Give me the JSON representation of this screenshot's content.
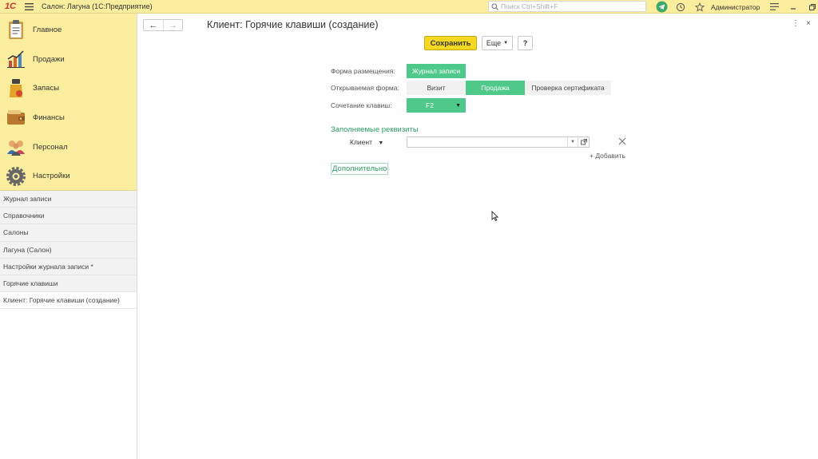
{
  "titlebar": {
    "logo": "1С",
    "app_title": "Салон: Лагуна  (1С:Предприятие)",
    "search_placeholder": "Поиск Ctrl+Shift+F",
    "user": "Администратор"
  },
  "sidebar": {
    "sections": [
      {
        "label": "Главное",
        "icon": "clipboard-icon"
      },
      {
        "label": "Продажи",
        "icon": "sales-chart-icon"
      },
      {
        "label": "Запасы",
        "icon": "goods-icon"
      },
      {
        "label": "Финансы",
        "icon": "wallet-icon"
      },
      {
        "label": "Персонал",
        "icon": "people-icon"
      },
      {
        "label": "Настройки",
        "icon": "gear-icon"
      }
    ],
    "open_windows": [
      "Журнал записи",
      "Справочники",
      "Салоны",
      "Лагуна (Салон)",
      "Настройки журнала записи *",
      "Горячие клавиши",
      "Клиент: Горячие клавиши (создание)"
    ]
  },
  "form": {
    "title": "Клиент: Горячие клавиши (создание)",
    "save_label": "Сохранить",
    "more_label": "Еще",
    "help_label": "?",
    "placement_label": "Форма размещения:",
    "placement_value": "Журнал записи",
    "open_form_label": "Открываемая форма:",
    "open_form_options": [
      "Визит",
      "Продажа",
      "Проверка сертификата"
    ],
    "open_form_selected": "Продажа",
    "hotkey_label": "Сочетание клавиш:",
    "hotkey_value": "F2",
    "fields_header": "Заполняемые реквизиты",
    "client_label": "Клиент",
    "add_label": "+ Добавить",
    "more_link": "Дополнительно"
  },
  "colors": {
    "titlebar": "#fbed9e",
    "accent_green": "#4ec98a",
    "save_yellow": "#f5d822"
  }
}
